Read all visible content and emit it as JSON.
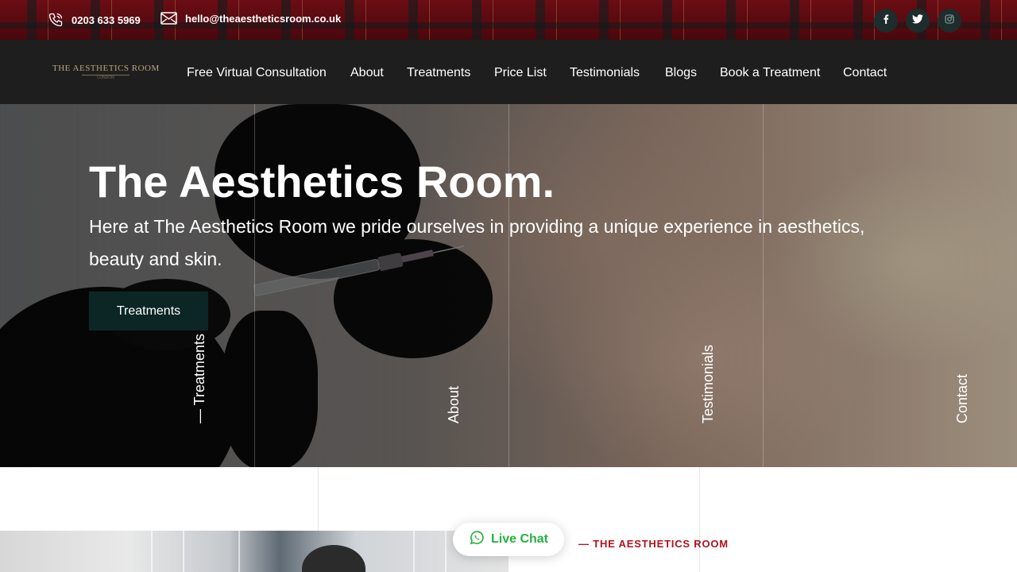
{
  "topbar": {
    "phone": "0203 633 5969",
    "email": "hello@theaestheticsroom.co.uk",
    "phone_icon": "phone-icon",
    "email_icon": "envelope-icon",
    "social": [
      {
        "name": "facebook",
        "glyph": "f"
      },
      {
        "name": "twitter",
        "glyph": ""
      },
      {
        "name": "instagram",
        "glyph": ""
      }
    ]
  },
  "nav": {
    "logo_text": "THE AESTHETICS ROOM",
    "logo_sub": "LONDON",
    "items": [
      {
        "label": "Free Virtual Consultation"
      },
      {
        "label": "About"
      },
      {
        "label": "Treatments"
      },
      {
        "label": "Price List"
      },
      {
        "label": "Testimonials"
      },
      {
        "label": "Blogs"
      },
      {
        "label": "Book a Treatment"
      },
      {
        "label": "Contact"
      }
    ]
  },
  "hero": {
    "title": "The Aesthetics Room.",
    "subtitle": "Here at The Aesthetics Room we pride ourselves in providing a unique experience in aesthetics, beauty and skin.",
    "button_label": "Treatments",
    "vertical_links": [
      {
        "label": "— Treatments"
      },
      {
        "label": "About"
      },
      {
        "label": "Testimonials"
      },
      {
        "label": "Contact"
      }
    ]
  },
  "section": {
    "eyebrow": "— THE AESTHETICS ROOM"
  },
  "livechat": {
    "label": "Live Chat",
    "icon": "whatsapp-icon"
  },
  "colors": {
    "topbar_red": "#5a0a10",
    "nav_bg": "#1e1e1e",
    "button_bg": "#0c2626",
    "accent_red": "#b0121b",
    "chat_green": "#25b33f"
  }
}
